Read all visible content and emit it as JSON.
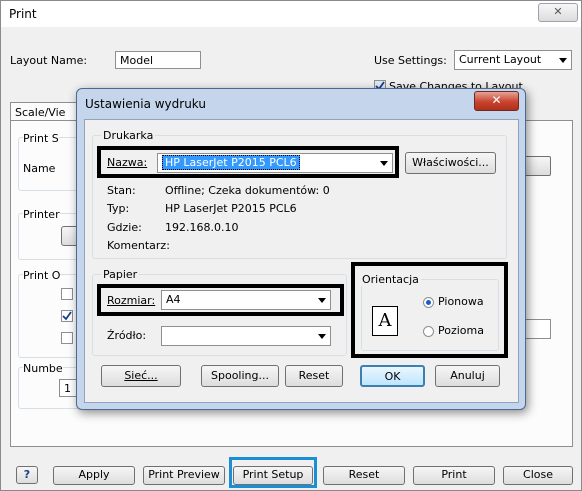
{
  "main_window": {
    "title": "Print",
    "close_glyph": "✕",
    "layout_name_label": "Layout Name:",
    "layout_name_value": "Model",
    "use_settings_label": "Use Settings:",
    "use_settings_value": "Current Layout",
    "save_changes_label": "Save Changes to Layout",
    "tab_label": "Scale/Vie",
    "partial_labels": [
      "Print S",
      "Name",
      "Printer",
      "Print O",
      "Numbe"
    ],
    "number_value": "1",
    "help_glyph": "?",
    "buttons": {
      "apply": "Apply",
      "print_preview": "Print Preview",
      "print_setup": "Print Setup",
      "reset": "Reset",
      "print": "Print",
      "close": "Close"
    },
    "highlight_color": "#1a8fd6"
  },
  "dialog": {
    "title": "Ustawienia wydruku",
    "close_glyph": "✕",
    "printer_group": "Drukarka",
    "name_label": "Nazwa:",
    "name_value": "HP LaserJet P2015 PCL6",
    "properties_button": "Właściwości...",
    "status_label": "Stan:",
    "status_value": "Offline; Czeka dokumentów: 0",
    "type_label": "Typ:",
    "type_value": "HP LaserJet P2015 PCL6",
    "where_label": "Gdzie:",
    "where_value": "192.168.0.10",
    "comment_label": "Komentarz:",
    "paper_group": "Papier",
    "size_label": "Rozmiar:",
    "size_value": "A4",
    "source_label": "Źródło:",
    "source_value": "",
    "orientation_group": "Orientacja",
    "portrait_label": "Pionowa",
    "landscape_label": "Pozioma",
    "portrait_selected": true,
    "orientation_icon_letter": "A",
    "buttons": {
      "network": "Sieć...",
      "spooling": "Spooling...",
      "reset": "Reset",
      "ok": "OK",
      "cancel": "Anuluj"
    }
  }
}
